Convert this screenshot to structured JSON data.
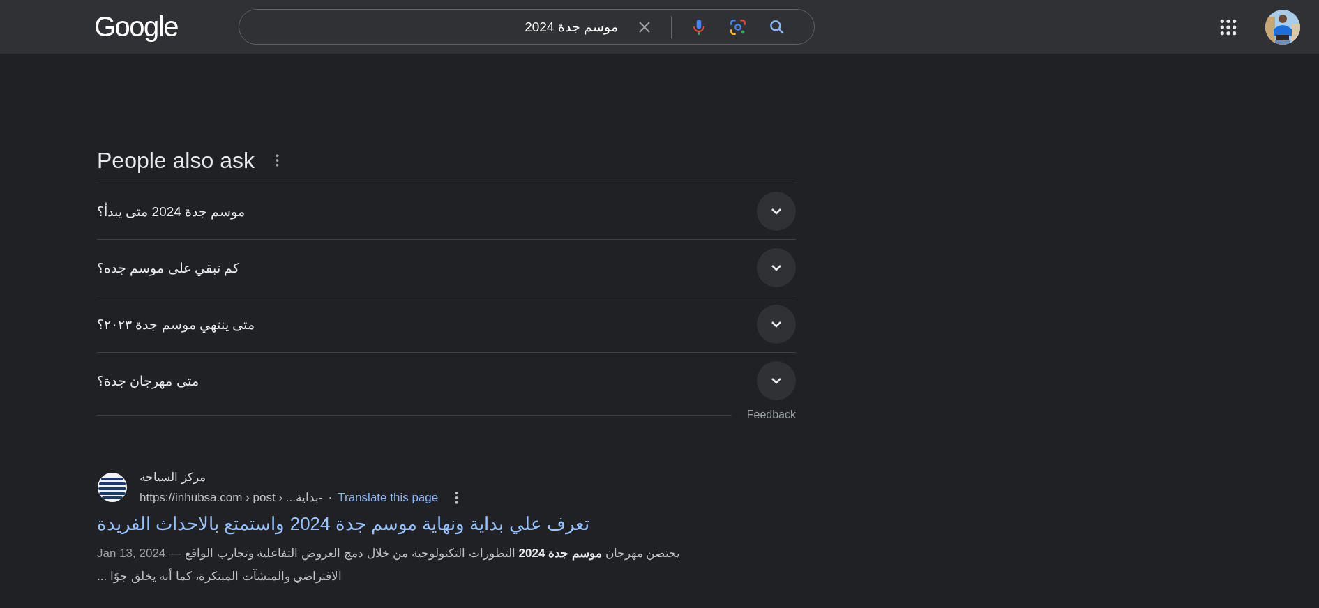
{
  "header": {
    "logo": "Google",
    "search": {
      "value": "موسم جدة 2024"
    }
  },
  "people_also_ask": {
    "title": "People also ask",
    "questions": [
      {
        "text": "موسم جدة 2024 متى يبدأ؟",
        "expanded": false
      },
      {
        "text": "كم تبقي على موسم جده؟",
        "expanded": false
      },
      {
        "text": "متى ينتهي موسم جدة ٢٠٢٣؟",
        "expanded": false
      },
      {
        "text": "متى مهرجان جدة؟",
        "expanded": false
      }
    ],
    "feedback": "Feedback"
  },
  "results": [
    {
      "site_name": "مركز السياحة",
      "url": "https://inhubsa.com › post › ...بداية-",
      "separator": "·",
      "translate": "Translate this page",
      "title": "تعرف علي بداية ونهاية موسم جدة 2024 واستمتع بالاحداث الفريدة",
      "date": "Jan 13, 2024 —",
      "snippet": "يحتضن مهرجان **موسم جدة 2024** التطورات التكنولوجية من خلال دمج العروض التفاعلية وتجارب الواقع الافتراضي والمنشآت المبتكرة، كما أنه يخلق جوًا ..."
    }
  ]
}
